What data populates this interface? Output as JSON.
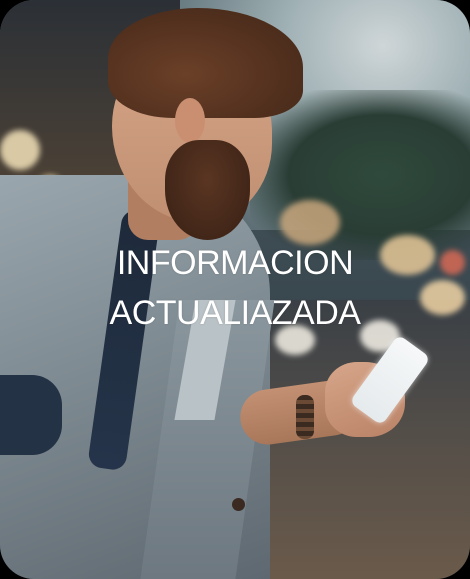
{
  "card": {
    "title_line_1": "INFORMACION",
    "title_line_2": "ACTUALIAZADA",
    "text_color": "#ffffff",
    "image_subject": "man-with-phone"
  }
}
